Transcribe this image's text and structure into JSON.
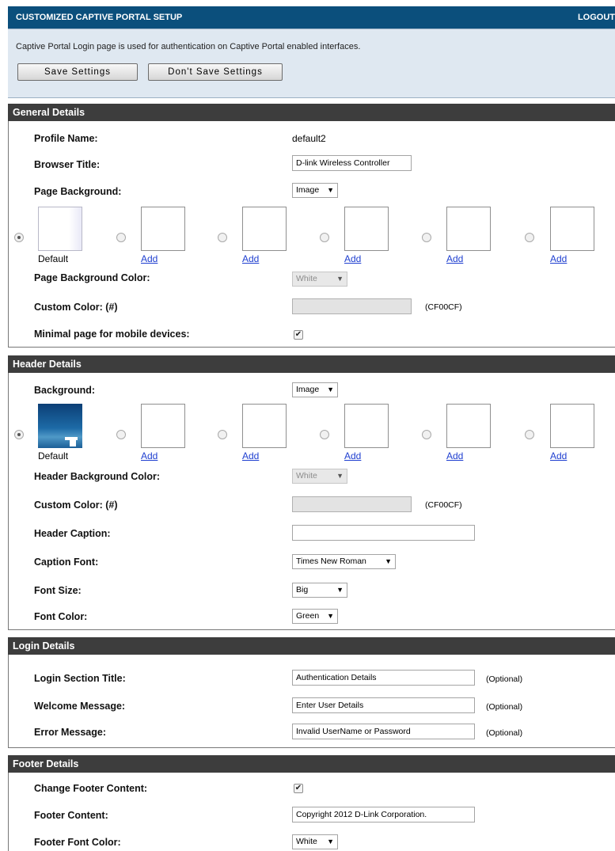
{
  "header": {
    "title": "CUSTOMIZED CAPTIVE PORTAL SETUP",
    "logout": "LOGOUT"
  },
  "info": {
    "description": "Captive Portal Login page is used for authentication on Captive Portal enabled interfaces.",
    "save_label": "Save Settings",
    "dont_save_label": "Don't Save Settings"
  },
  "general": {
    "heading": "General Details",
    "profile_name_label": "Profile Name:",
    "profile_name_value": "default2",
    "browser_title_label": "Browser Title:",
    "browser_title_value": "D-link Wireless Controller",
    "page_background_label": "Page Background:",
    "page_background_value": "Image",
    "default_caption": "Default",
    "add_link": "Add",
    "bg_color_label": "Page Background Color:",
    "bg_color_value": "White",
    "custom_color_label": "Custom Color: (#)",
    "custom_color_hint": "(CF00CF)",
    "mobile_label": "Minimal page for mobile devices:",
    "mobile_checked": true
  },
  "header_details": {
    "heading": "Header Details",
    "background_label": "Background:",
    "background_value": "Image",
    "default_caption": "Default",
    "add_link": "Add",
    "bg_color_label": "Header Background Color:",
    "bg_color_value": "White",
    "custom_color_label": "Custom Color: (#)",
    "custom_color_hint": "(CF00CF)",
    "caption_label": "Header Caption:",
    "caption_value": "",
    "font_label": "Caption Font:",
    "font_value": "Times New Roman",
    "size_label": "Font Size:",
    "size_value": "Big",
    "color_label": "Font Color:",
    "color_value": "Green"
  },
  "login": {
    "heading": "Login Details",
    "title_label": "Login Section Title:",
    "title_value": "Authentication Details",
    "welcome_label": "Welcome Message:",
    "welcome_value": "Enter User Details",
    "error_label": "Error Message:",
    "error_value": "Invalid UserName or Password",
    "optional": "(Optional)"
  },
  "footer": {
    "heading": "Footer Details",
    "change_label": "Change Footer Content:",
    "change_checked": true,
    "content_label": "Footer Content:",
    "content_value": "Copyright 2012 D-Link Corporation.",
    "color_label": "Footer Font Color:",
    "color_value": "White"
  },
  "colors": {
    "topbar": "#0b4f7c",
    "section_header": "#3d3d3d",
    "info_panel": "#dfe8f1",
    "link": "#1f3fd0"
  }
}
